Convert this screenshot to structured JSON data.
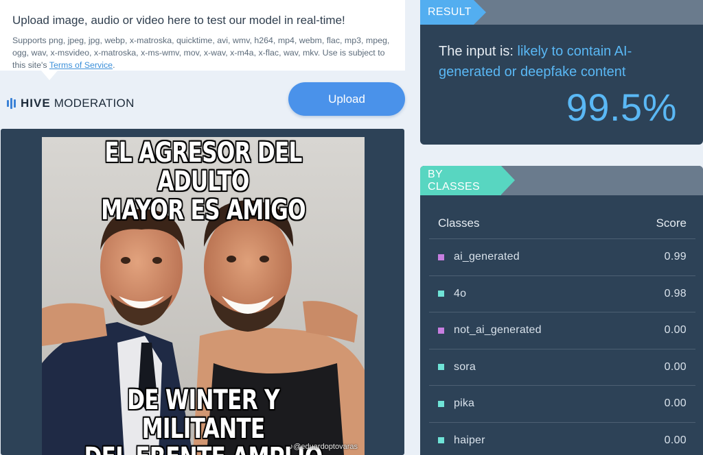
{
  "upload": {
    "title": "Upload image, audio or video here to test our model in real-time!",
    "desc": "Supports png, jpeg, jpg, webp, x-matroska, quicktime, avi, wmv, h264, mp4, webm, flac, mp3, mpeg, ogg, wav, x-msvideo, x-matroska, x-ms-wmv, mov, x-wav, x-m4a, x-flac, wav, mkv. Use is subject to this site's ",
    "terms_link": "Terms of Service",
    "terms_suffix": ".",
    "button": "Upload"
  },
  "brand": {
    "bold": "HIVE",
    "light": "MODERATION",
    "accent": "#3b82d6"
  },
  "image": {
    "top_text_line1": "EL AGRESOR DEL  ADULTO",
    "top_text_line2": "MAYOR  ES  AMIGO",
    "bottom_text_line1": "DE WINTER Y MILITANTE",
    "bottom_text_line2": "DEL FRENTE AMPLIO",
    "watermark": "♪@eduardoptovaras"
  },
  "result": {
    "tag": "RESULT",
    "prefix": "The input is: ",
    "verdict": "likely to contain AI-generated or deepfake content",
    "score": "99.5%"
  },
  "classes": {
    "tag": "BY CLASSES",
    "col_class": "Classes",
    "col_score": "Score",
    "rows": [
      {
        "name": "ai_generated",
        "score": "0.99",
        "color": "#c77ee0"
      },
      {
        "name": "4o",
        "score": "0.98",
        "color": "#6fe3d7"
      },
      {
        "name": "not_ai_generated",
        "score": "0.00",
        "color": "#c77ee0"
      },
      {
        "name": "sora",
        "score": "0.00",
        "color": "#6fe3d7"
      },
      {
        "name": "pika",
        "score": "0.00",
        "color": "#6fe3d7"
      },
      {
        "name": "haiper",
        "score": "0.00",
        "color": "#6fe3d7"
      }
    ]
  }
}
